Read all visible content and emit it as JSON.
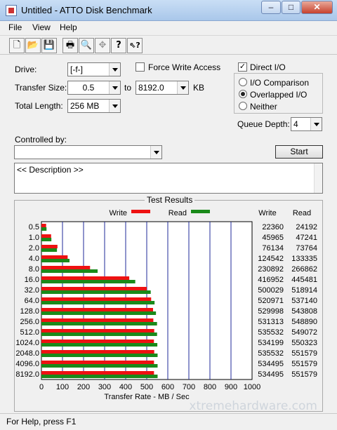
{
  "window": {
    "title": "Untitled - ATTO Disk Benchmark",
    "minimize": "–",
    "maximize": "□",
    "close": "✕"
  },
  "menu": [
    "File",
    "View",
    "Help"
  ],
  "toolbar": [
    {
      "name": "new-icon",
      "glyph": "🗋"
    },
    {
      "name": "open-icon",
      "glyph": "📂"
    },
    {
      "name": "save-icon",
      "glyph": "💾"
    },
    {
      "name": "print-icon",
      "glyph": "🖶"
    },
    {
      "name": "print-preview-icon",
      "glyph": "🔍"
    },
    {
      "name": "move-icon",
      "glyph": "✥"
    },
    {
      "name": "help-icon",
      "glyph": "?"
    },
    {
      "name": "context-help-icon",
      "glyph": "⇖?"
    }
  ],
  "settings": {
    "drive_label": "Drive:",
    "drive_value": "[-f-]",
    "force_write_label": "Force Write Access",
    "force_write_checked": false,
    "direct_io_label": "Direct I/O",
    "direct_io_checked": true,
    "transfer_size_label": "Transfer Size:",
    "transfer_size_from": "0.5",
    "to_label": "to",
    "transfer_size_to": "8192.0",
    "kb_label": "KB",
    "total_length_label": "Total Length:",
    "total_length_value": "256 MB",
    "io_comparison_label": "I/O Comparison",
    "overlapped_io_label": "Overlapped I/O",
    "neither_label": "Neither",
    "selected_mode": "Overlapped I/O",
    "queue_depth_label": "Queue Depth:",
    "queue_depth_value": "4",
    "controlled_by_label": "Controlled by:",
    "controlled_by_value": "",
    "start_label": "Start",
    "description_text": "<< Description >>"
  },
  "chart_data": {
    "type": "bar",
    "title": "Test Results",
    "categories": [
      "0.5",
      "1.0",
      "2.0",
      "4.0",
      "8.0",
      "16.0",
      "32.0",
      "64.0",
      "128.0",
      "256.0",
      "512.0",
      "1024.0",
      "2048.0",
      "4096.0",
      "8192.0"
    ],
    "series": [
      {
        "name": "Write",
        "color": "#ee1111",
        "values": [
          22360,
          45965,
          76134,
          124542,
          230892,
          416952,
          500029,
          520971,
          529998,
          531313,
          535532,
          534199,
          535532,
          534495,
          534495
        ]
      },
      {
        "name": "Read",
        "color": "#1a8a1a",
        "values": [
          24192,
          47241,
          73764,
          133335,
          266862,
          445481,
          518914,
          537140,
          543808,
          548890,
          549072,
          550323,
          551579,
          551579,
          551579
        ]
      }
    ],
    "xlabel": "Transfer Rate - MB / Sec",
    "xlim": [
      0,
      1000
    ],
    "xticks": [
      "0",
      "100",
      "200",
      "300",
      "400",
      "500",
      "600",
      "700",
      "800",
      "900",
      "1000"
    ],
    "column_headers": [
      "Write",
      "Read"
    ],
    "grid": true
  },
  "status": {
    "text": "For Help, press F1"
  },
  "watermark": "xtremehardware.com"
}
